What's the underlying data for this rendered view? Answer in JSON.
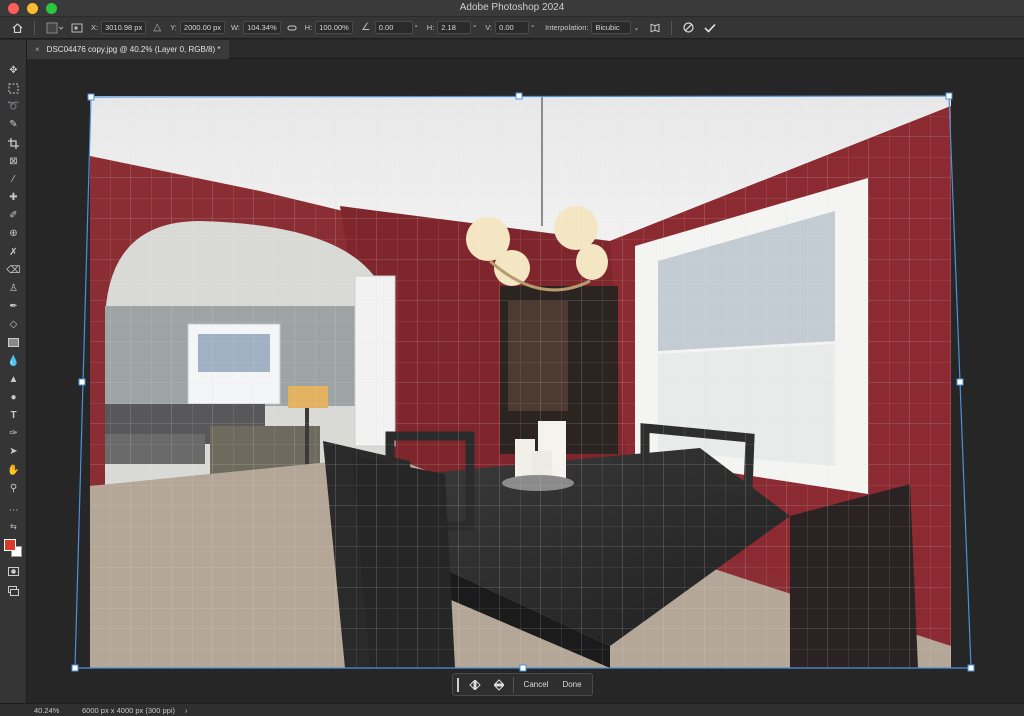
{
  "app": {
    "title": "Adobe Photoshop 2024"
  },
  "options_bar": {
    "x_label": "X:",
    "x_value": "3010.98 px",
    "y_label": "Y:",
    "y_value": "2000.00 px",
    "w_label": "W:",
    "w_value": "104.34%",
    "h_label": "H:",
    "h_value": "100.00%",
    "angle_value": "0.00",
    "angle_unit": "°",
    "hskew_label": "H:",
    "hskew_value": "2.18",
    "hskew_unit": "°",
    "vskew_label": "V:",
    "vskew_value": "0.00",
    "vskew_unit": "°",
    "interp_label": "Interpolation:",
    "interp_value": "Bicubic"
  },
  "document": {
    "tab_title": "DSC04476 copy.jpg @ 40.2% (Layer 0, RGB/8) *"
  },
  "warp_panel": {
    "cancel_label": "Cancel",
    "done_label": "Done"
  },
  "status_bar": {
    "zoom": "40.24%",
    "doc_info": "6000 px x 4000 px (300 ppi)",
    "arrow": "›"
  },
  "colors": {
    "foreground": "#d93a2b",
    "background": "#ffffff",
    "accent": "#4d90d8"
  },
  "icons": [
    "home-icon",
    "transform-reference-icon",
    "link-icon",
    "angle-icon",
    "warp-icon",
    "cancel-icon",
    "commit-icon"
  ]
}
